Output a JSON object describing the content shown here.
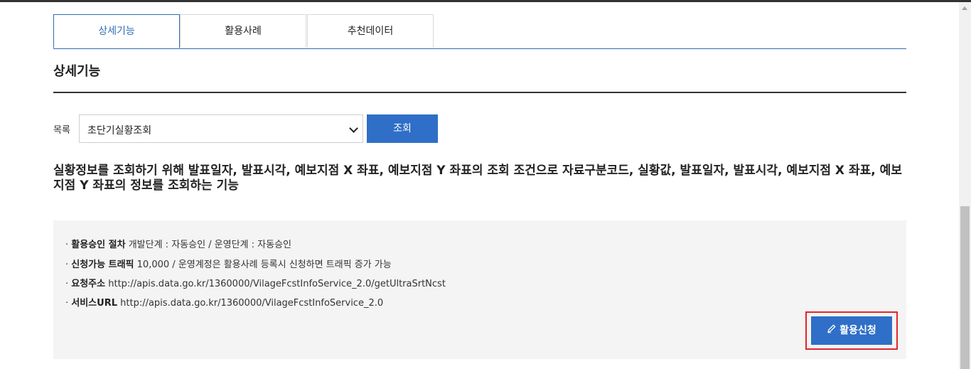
{
  "tabs": [
    {
      "label": "상세기능",
      "active": true
    },
    {
      "label": "활용사례",
      "active": false
    },
    {
      "label": "추천데이터",
      "active": false
    }
  ],
  "section": {
    "title": "상세기능"
  },
  "query": {
    "list_label": "목록",
    "selected_option": "초단기실황조회",
    "button_label": "조회"
  },
  "description": "실황정보를 조회하기 위해 발표일자, 발표시각, 예보지점 X 좌표, 예보지점 Y 좌표의 조회 조건으로 자료구분코드, 실황값, 발표일자, 발표시각, 예보지점 X 좌표, 예보지점 Y 좌표의 정보를 조회하는 기능",
  "info": [
    {
      "key": "활용승인 절차",
      "value": "개발단계 : 자동승인 / 운영단계 : 자동승인"
    },
    {
      "key": "신청가능 트래픽",
      "value": "10,000 / 운영계정은 활용사례 등록시 신청하면 트래픽 증가 가능"
    },
    {
      "key": "요청주소",
      "value": "http://apis.data.go.kr/1360000/VilageFcstInfoService_2.0/getUltraSrtNcst"
    },
    {
      "key": "서비스URL",
      "value": "http://apis.data.go.kr/1360000/VilageFcstInfoService_2.0"
    }
  ],
  "apply_button": {
    "label": "활용신청",
    "icon": "pencil-icon"
  },
  "colors": {
    "accent": "#2f6fc7",
    "highlight": "#e0262a"
  }
}
